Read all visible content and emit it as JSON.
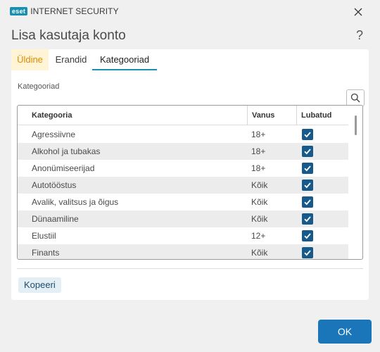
{
  "app": {
    "logo_badge": "eset",
    "product_name": "INTERNET SECURITY"
  },
  "dialog": {
    "title": "Lisa kasutaja konto",
    "help": "?"
  },
  "tabs": [
    {
      "label": "Üldine"
    },
    {
      "label": "Erandid"
    },
    {
      "label": "Kategooriad"
    }
  ],
  "section_label": "Kategooriad",
  "table": {
    "columns": [
      "Kategooria",
      "Vanus",
      "Lubatud"
    ],
    "rows": [
      {
        "name": "Agressiivne",
        "age": "18+",
        "allowed": true
      },
      {
        "name": "Alkohol ja tubakas",
        "age": "18+",
        "allowed": true
      },
      {
        "name": "Anonümiseerijad",
        "age": "18+",
        "allowed": true
      },
      {
        "name": "Autotööstus",
        "age": "Kõik",
        "allowed": true
      },
      {
        "name": "Avalik, valitsus ja õigus",
        "age": "Kõik",
        "allowed": true
      },
      {
        "name": "Dünaamiline",
        "age": "Kõik",
        "allowed": true
      },
      {
        "name": "Elustiil",
        "age": "12+",
        "allowed": true
      },
      {
        "name": "Finants",
        "age": "Kõik",
        "allowed": true
      }
    ]
  },
  "buttons": {
    "copy": "Kopeeri",
    "ok": "OK"
  },
  "colors": {
    "accent": "#1a8fb0",
    "checkbox": "#155a8a",
    "ok_button": "#1a76b8",
    "warn_tab": "#e08a00"
  }
}
